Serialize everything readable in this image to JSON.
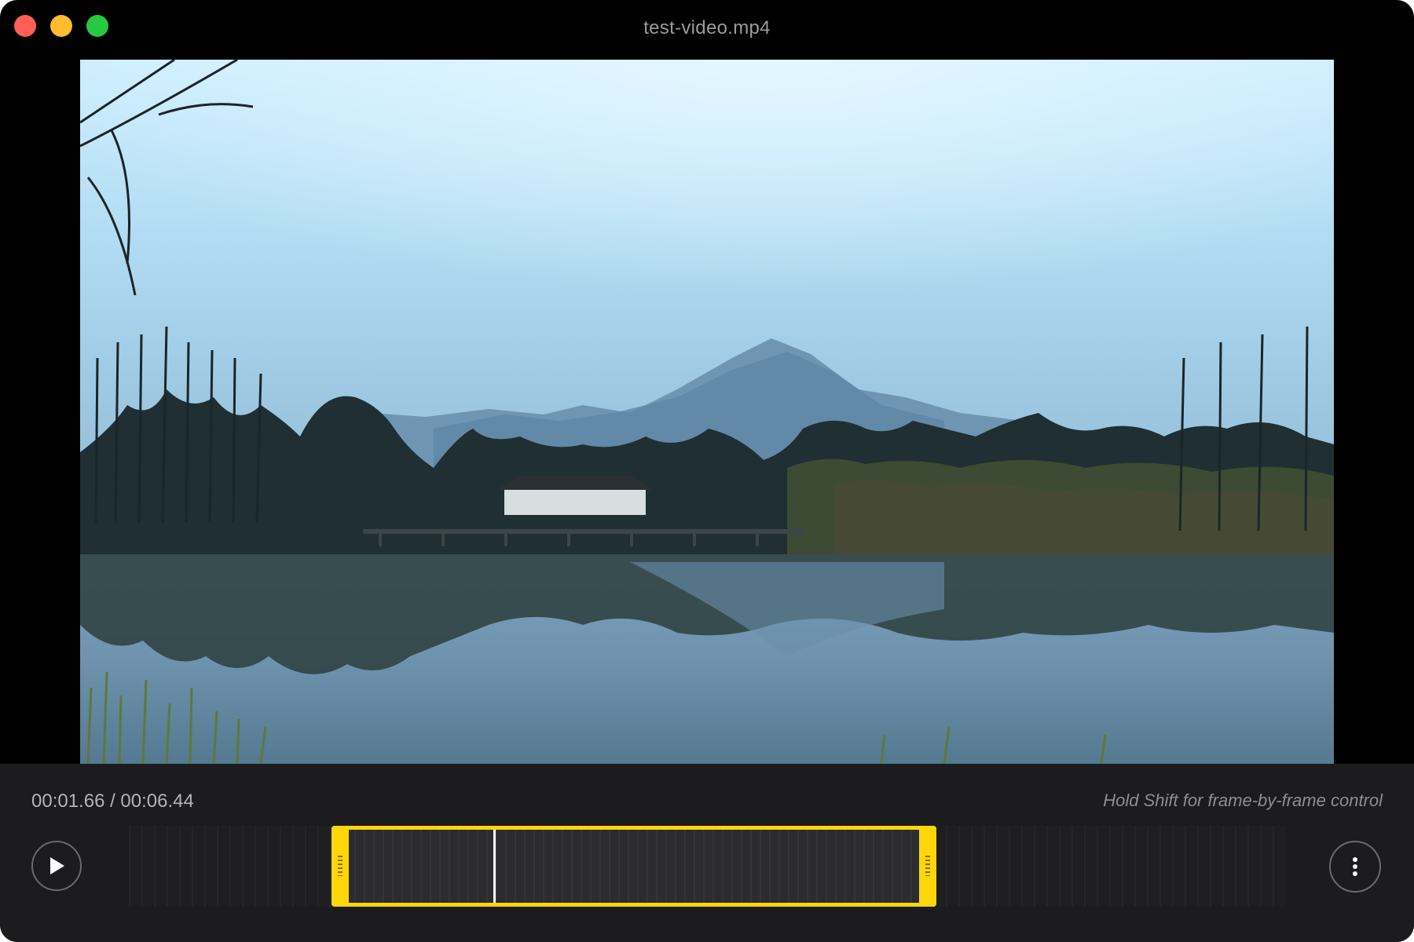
{
  "window": {
    "title": "test-video.mp4"
  },
  "controls": {
    "time_display": "00:01.66 / 00:06.44",
    "hint": "Hold Shift for frame-by-frame control",
    "play_icon": "play-icon",
    "more_icon": "more-vertical-icon"
  },
  "trim": {
    "current_seconds": 1.66,
    "duration_seconds": 6.44
  },
  "colors": {
    "accent": "#ffd60a",
    "close": "#ff5f57",
    "minimize": "#febc2e",
    "zoom": "#28c840"
  }
}
